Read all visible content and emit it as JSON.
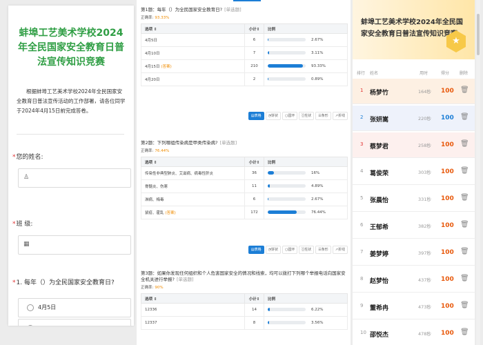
{
  "form": {
    "title": "蚌埠工艺美术学校2024年全民国家安全教育日普法宣传知识竞赛",
    "intro": "根据蚌埠工艺美术学校2024年全民国家安全教育日普法宣传活动的工作部署，请各位同学于2024年4月15日前完成答卷。",
    "name_label": "您的姓名:",
    "name_icon": "user-icon",
    "class_label": "班  级:",
    "class_icon": "grid-icon",
    "q1_label": "1. 每年（）为全民国家安全教育日?",
    "q1_first_option": "4月5日"
  },
  "stats": {
    "questions": [
      {
        "title": "第1题：每年（）为全民国家安全教育日?",
        "type": "[单选题]",
        "rate_label": "正确率:",
        "rate": "93.33%",
        "headers": [
          "选项",
          "小计",
          "比例"
        ],
        "rows": [
          {
            "option": "4月5日",
            "tag": "",
            "count": "6",
            "pct": "2.67%",
            "fill": 0.0267
          },
          {
            "option": "4月10日",
            "tag": "",
            "count": "7",
            "pct": "3.11%",
            "fill": 0.0311
          },
          {
            "option": "4月15日",
            "tag": "(答案)",
            "count": "210",
            "pct": "93.33%",
            "fill": 0.9333
          },
          {
            "option": "4月20日",
            "tag": "",
            "count": "2",
            "pct": "0.89%",
            "fill": 0.0089
          }
        ]
      },
      {
        "title": "第2题：下列哪组传染病是甲类传染病?",
        "type": "[单选题]",
        "rate_label": "正确率:",
        "rate": "76.44%",
        "headers": [
          "选项",
          "小计",
          "比例"
        ],
        "rows": [
          {
            "option": "传染性非典型肺炎、艾滋病、病毒性肝炎",
            "tag": "",
            "count": "36",
            "pct": "16%",
            "fill": 0.16
          },
          {
            "option": "脊髓炎、伤寒",
            "tag": "",
            "count": "11",
            "pct": "4.89%",
            "fill": 0.0489
          },
          {
            "option": "淋病、梅毒",
            "tag": "",
            "count": "6",
            "pct": "2.67%",
            "fill": 0.0267
          },
          {
            "option": "鼠疫、霍乱",
            "tag": "(答案)",
            "count": "172",
            "pct": "76.44%",
            "fill": 0.7644
          }
        ]
      },
      {
        "title": "第3题：如果你发现任何组织和个人危害国家安全的情况和线索，均可以拨打下列哪个举报电话向国家安全机关进行举报?",
        "type": "[单选题]",
        "rate_label": "正确率:",
        "rate": "90%",
        "headers": [
          "选项",
          "小计",
          "比例"
        ],
        "rows": [
          {
            "option": "12336",
            "tag": "",
            "count": "14",
            "pct": "6.22%",
            "fill": 0.0622
          },
          {
            "option": "12337",
            "tag": "",
            "count": "8",
            "pct": "3.56%",
            "fill": 0.0356
          }
        ]
      }
    ],
    "toolbar": [
      "表格",
      "饼状",
      "圆环",
      "柱状",
      "条形",
      "折线"
    ],
    "bar_color": "#1c7ed6",
    "answer_color": "#f08c00"
  },
  "leaderboard": {
    "title": "蚌埠工艺美术学校2024年全民国家安全教育日普法宣传知识竞赛",
    "badge_icon": "star-badge-icon",
    "headers": {
      "rank": "排行",
      "name": "姓名",
      "time": "用时",
      "score": "得分",
      "del": "删除"
    },
    "delete_icon": "trash-icon",
    "rows": [
      {
        "rank": "1",
        "name": "杨梦竹",
        "time": "164秒",
        "score": "100",
        "bg": "#fdf0e3",
        "score_color": "#e8590c",
        "rank_color": "#e03131"
      },
      {
        "rank": "2",
        "name": "张妍嵩",
        "time": "220秒",
        "score": "100",
        "bg": "#eef2fb",
        "score_color": "#1c7ed6",
        "rank_color": "#1c7ed6"
      },
      {
        "rank": "3",
        "name": "蔡梦君",
        "time": "258秒",
        "score": "100",
        "bg": "#fdf0ee",
        "score_color": "#e8590c",
        "rank_color": "#e03131"
      },
      {
        "rank": "4",
        "name": "葛俊荣",
        "time": "303秒",
        "score": "100",
        "bg": "#ffffff",
        "score_color": "#e8590c",
        "rank_color": "#999999"
      },
      {
        "rank": "5",
        "name": "张晨怡",
        "time": "331秒",
        "score": "100",
        "bg": "#ffffff",
        "score_color": "#e8590c",
        "rank_color": "#999999"
      },
      {
        "rank": "6",
        "name": "王郁希",
        "time": "382秒",
        "score": "100",
        "bg": "#ffffff",
        "score_color": "#e8590c",
        "rank_color": "#999999"
      },
      {
        "rank": "7",
        "name": "姜梦婷",
        "time": "397秒",
        "score": "100",
        "bg": "#ffffff",
        "score_color": "#e8590c",
        "rank_color": "#999999"
      },
      {
        "rank": "8",
        "name": "赵梦怡",
        "time": "437秒",
        "score": "100",
        "bg": "#ffffff",
        "score_color": "#e8590c",
        "rank_color": "#999999"
      },
      {
        "rank": "9",
        "name": "董希冉",
        "time": "473秒",
        "score": "100",
        "bg": "#ffffff",
        "score_color": "#e8590c",
        "rank_color": "#999999"
      },
      {
        "rank": "10",
        "name": "邵悦杰",
        "time": "478秒",
        "score": "100",
        "bg": "#ffffff",
        "score_color": "#e8590c",
        "rank_color": "#999999"
      }
    ]
  }
}
